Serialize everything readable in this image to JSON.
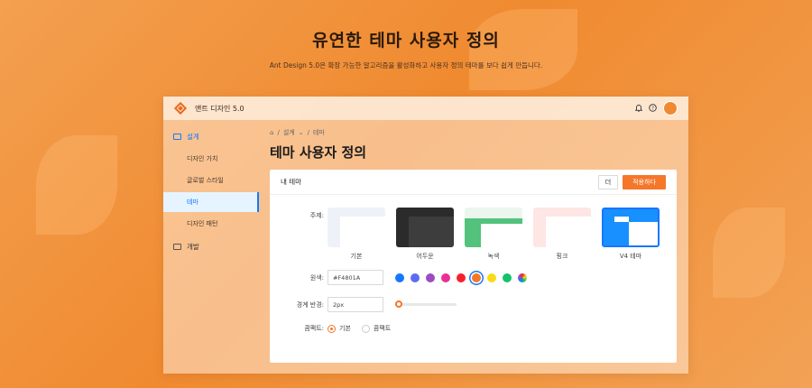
{
  "hero": {
    "title": "유연한 테마 사용자 정의",
    "description": "Ant Design 5.0은 확장 가능한 알고리즘을 활성화하고 사용자 정의 테마를 보다 쉽게 만듭니다."
  },
  "app": {
    "brand": "앤트 디자인 5.0",
    "header_icons": [
      "bell-icon",
      "help-icon"
    ],
    "accent": "#F5772A"
  },
  "sidebar": {
    "group_design": "설계",
    "items": [
      "디자인 가치",
      "글로벌 스타일",
      "테마",
      "디자인 패턴"
    ],
    "selected_index": 2,
    "group_dev": "개발"
  },
  "breadcrumb": {
    "home": "⌂",
    "design": "설계",
    "current": "테마"
  },
  "page_title": "테마 사용자 정의",
  "card": {
    "title": "내 테마",
    "more_button": "더",
    "apply_button": "적용하다"
  },
  "form": {
    "theme_label": "주제:",
    "themes": [
      "기본",
      "어두운",
      "녹색",
      "핑크",
      "V4 테마"
    ],
    "selected_theme": "V4 테마",
    "color_label": "원색:",
    "color_value": "#F4801A",
    "swatches": [
      "#1677ff",
      "#5b6cf0",
      "#9b4cc4",
      "#eb2f96",
      "#f5222d",
      "#f5772a",
      "#fadb14",
      "#13c26b",
      "multicolor"
    ],
    "selected_swatch": "#f5772a",
    "radius_label": "경계 반경:",
    "radius_value": "2px",
    "radius_level": 0.06,
    "compact_label": "콤팩트:",
    "compact_options": [
      "기본",
      "콤팩트"
    ],
    "compact_selected": "기본"
  }
}
